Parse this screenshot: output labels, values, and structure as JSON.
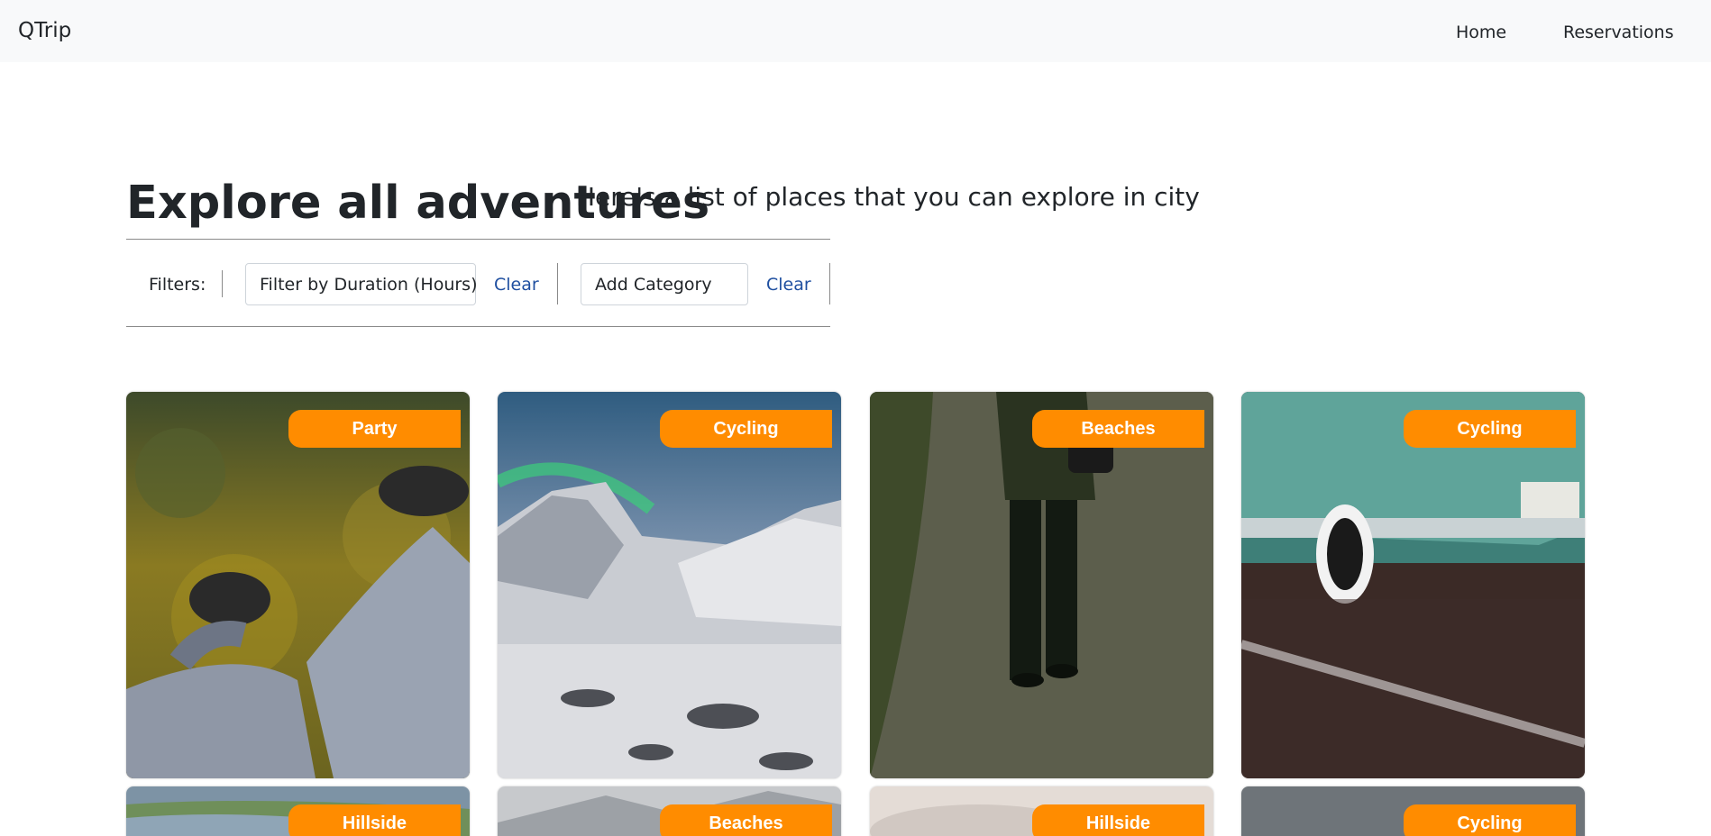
{
  "navbar": {
    "brand": "QTrip",
    "links": [
      "Home",
      "Reservations"
    ]
  },
  "header": {
    "title": "Explore all adventures",
    "subtitle": "Here's a list of places that you can explore in city"
  },
  "filters": {
    "label": "Filters:",
    "duration_placeholder": "Filter by Duration (Hours)",
    "category_placeholder": "Add Category",
    "clear_label": "Clear"
  },
  "adventures": [
    {
      "category": "Party",
      "image": "legs-over-forest"
    },
    {
      "category": "Cycling",
      "image": "snowy-mountain-aurora"
    },
    {
      "category": "Beaches",
      "image": "person-walking-path"
    },
    {
      "category": "Cycling",
      "image": "vintage-teal-car"
    },
    {
      "category": "Hillside",
      "image": "river-landscape"
    },
    {
      "category": "Beaches",
      "image": "misty-mountain"
    },
    {
      "category": "Hillside",
      "image": "cloudy-sky"
    },
    {
      "category": "Cycling",
      "image": "grey-sky"
    }
  ],
  "colors": {
    "badge": "#ff8c00",
    "navbar_bg": "#f8f9fa",
    "link": "#1f4fa0"
  }
}
